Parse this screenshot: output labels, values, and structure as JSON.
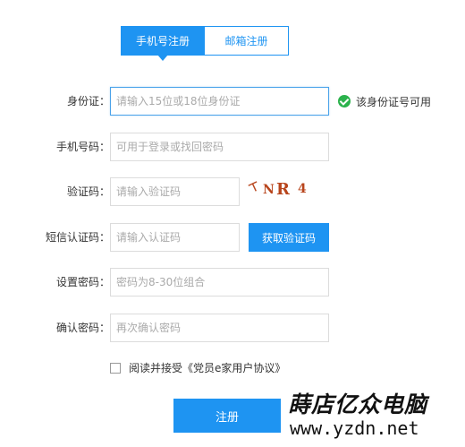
{
  "tabs": [
    {
      "label": "手机号注册",
      "active": true
    },
    {
      "label": "邮箱注册",
      "active": false
    }
  ],
  "form": {
    "id_card": {
      "label": "身份证：",
      "placeholder": "请输入15位或18位身份证",
      "validation": "该身份证号可用"
    },
    "phone": {
      "label": "手机号码：",
      "placeholder": "可用于登录或找回密码"
    },
    "captcha": {
      "label": "验证码：",
      "placeholder": "请输入验证码",
      "captcha_chars": [
        "ㄒ",
        "N",
        "R",
        "4"
      ]
    },
    "sms_code": {
      "label": "短信认证码：",
      "placeholder": "请输入认证码",
      "button": "获取验证码"
    },
    "password": {
      "label": "设置密码：",
      "placeholder": "密码为8-30位组合"
    },
    "confirm_password": {
      "label": "确认密码：",
      "placeholder": "再次确认密码"
    },
    "agreement": {
      "text": "阅读并接受《党员e家用户协议》"
    },
    "submit": "注册"
  },
  "watermark": {
    "name": "蒔店亿众电脑",
    "url": "www.yzdn.net"
  },
  "colors": {
    "accent": "#1e94f2",
    "success": "#2bb24c",
    "captcha": "#b8451c"
  }
}
